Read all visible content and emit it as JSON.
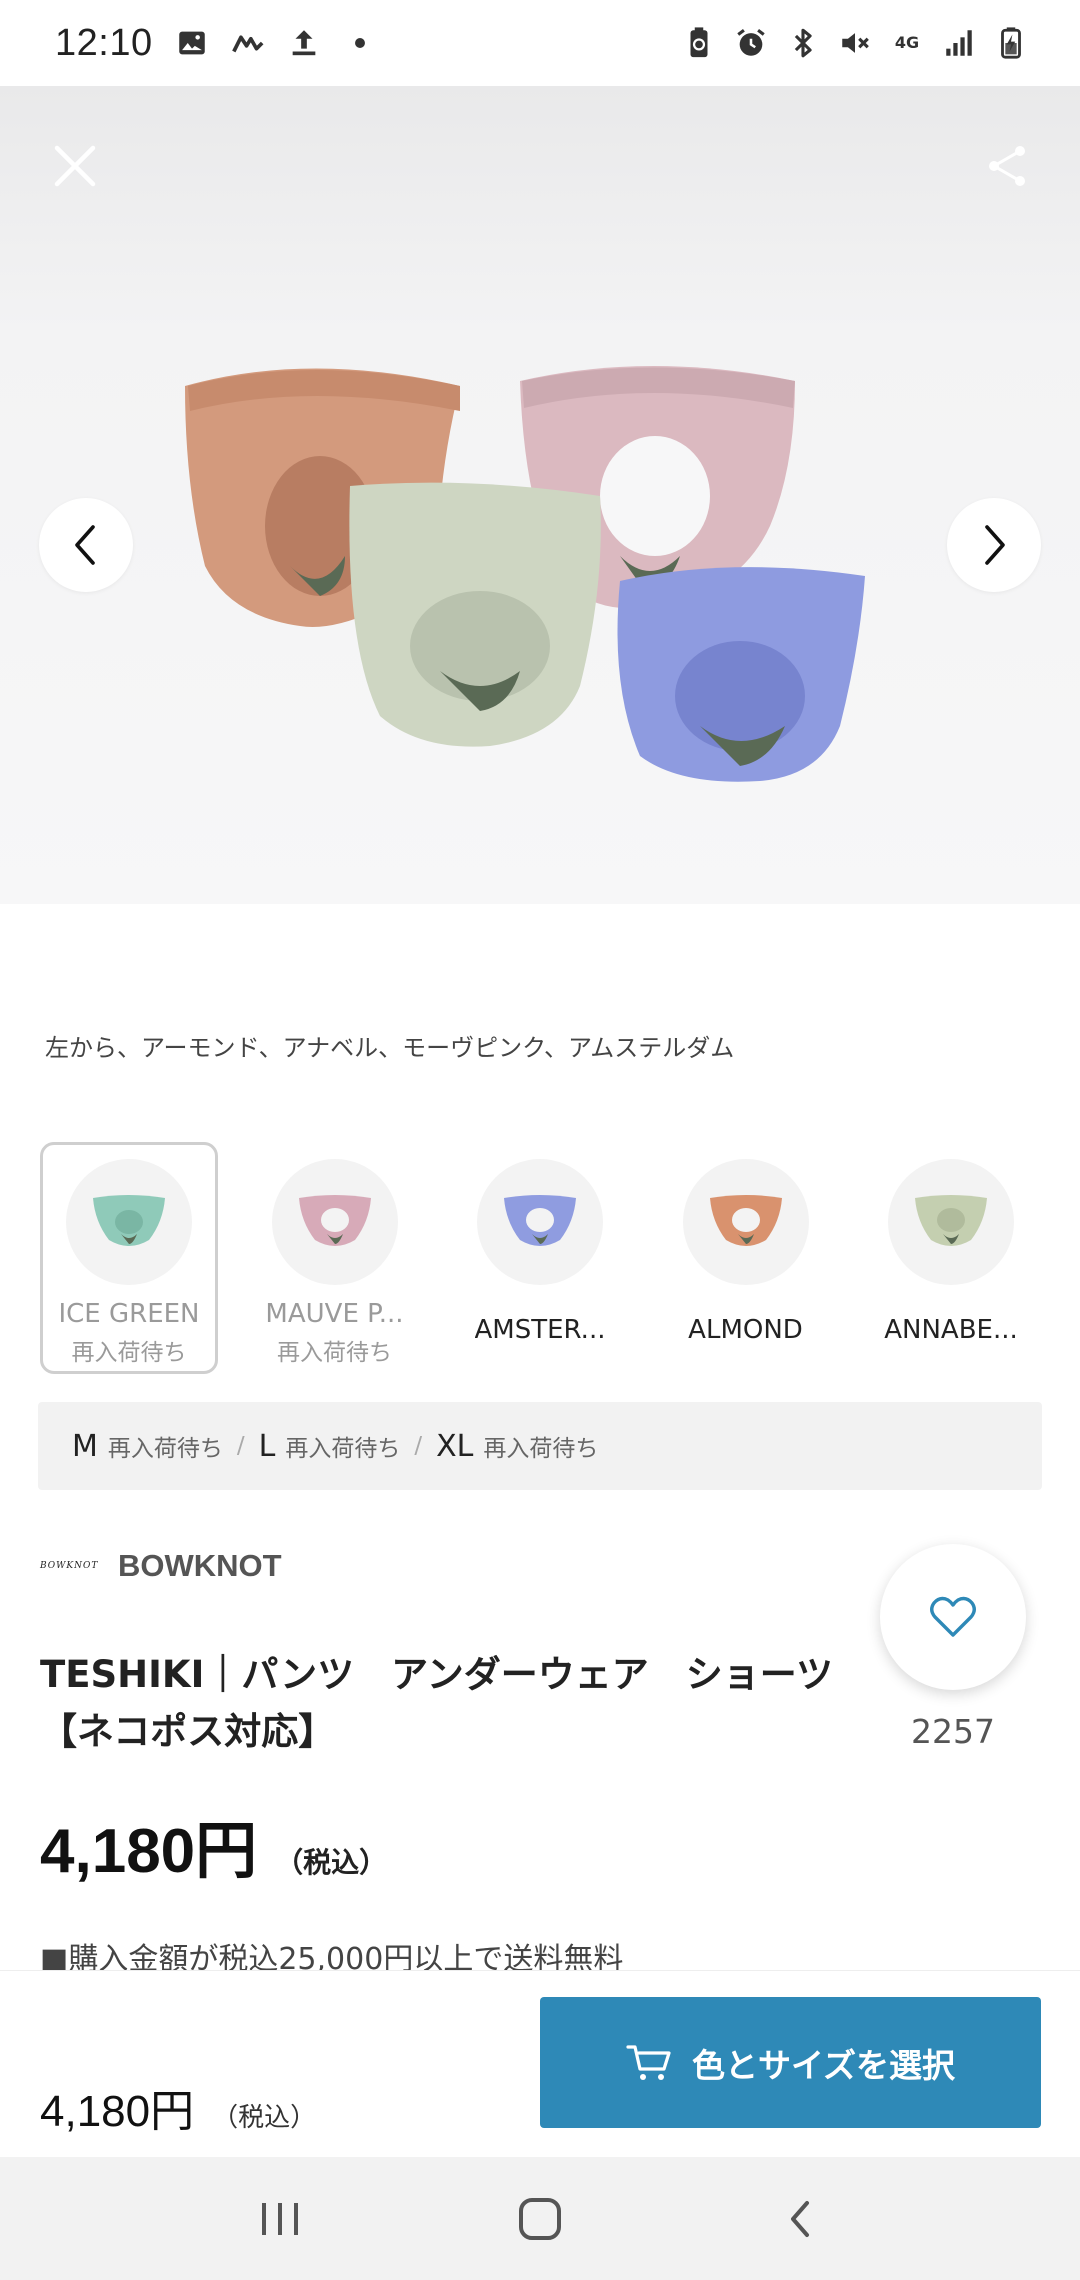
{
  "status_bar": {
    "time": "12:10",
    "left_icons": [
      "image-icon",
      "activity-icon",
      "upload-icon",
      "dot-icon"
    ],
    "right_icons": [
      "battery-saver-icon",
      "alarm-icon",
      "bluetooth-icon",
      "mute-icon",
      "network-4g-icon",
      "signal-icon",
      "battery-charging-icon"
    ],
    "network_label": "4G"
  },
  "hero": {
    "close_icon": "close-icon",
    "share_icon": "share-icon",
    "prev_icon": "chevron-left-icon",
    "next_icon": "chevron-right-icon",
    "product_colors": [
      "#d39a7d",
      "#dbb9c0",
      "#ced6c2",
      "#8e9be0"
    ]
  },
  "caption": "左から、アーモンド、アナベル、モーヴピンク、アムステルダム",
  "swatches": [
    {
      "name": "ICE GREEN",
      "stock": "再入荷待ち",
      "color": "#8fcab9",
      "selected": true,
      "dim": true
    },
    {
      "name": "MAUVE P...",
      "stock": "再入荷待ち",
      "color": "#d7aab8",
      "selected": false,
      "dim": true
    },
    {
      "name": "AMSTER...",
      "stock": "",
      "color": "#8f9ce0",
      "selected": false,
      "dim": false
    },
    {
      "name": "ALMOND",
      "stock": "",
      "color": "#d9926e",
      "selected": false,
      "dim": false
    },
    {
      "name": "ANNABE...",
      "stock": "",
      "color": "#c4cfb0",
      "selected": false,
      "dim": false
    }
  ],
  "sizes": [
    {
      "size": "M",
      "status": "再入荷待ち"
    },
    {
      "size": "L",
      "status": "再入荷待ち"
    },
    {
      "size": "XL",
      "status": "再入荷待ち"
    }
  ],
  "size_separator": "/",
  "brand": {
    "logo_text": "BOWKNOT",
    "name": "BOWKNOT"
  },
  "favorite": {
    "icon": "heart-icon",
    "count": "2257",
    "accent": "#2e89b7"
  },
  "product": {
    "title": "TESHIKI｜パンツ　アンダーウェア　ショーツ【ネコポス対応】",
    "price": "4,180円",
    "tax_label": "（税込）",
    "shipping_note": "■購入金額が税込25,000円以上で送料無料"
  },
  "buy_bar": {
    "price": "4,180円",
    "tax_label": "（税込）",
    "button_label": "色とサイズを選択",
    "button_icon": "cart-icon",
    "button_color": "#2e89b7"
  },
  "system_nav": [
    "recent-apps-icon",
    "home-icon",
    "back-icon"
  ]
}
